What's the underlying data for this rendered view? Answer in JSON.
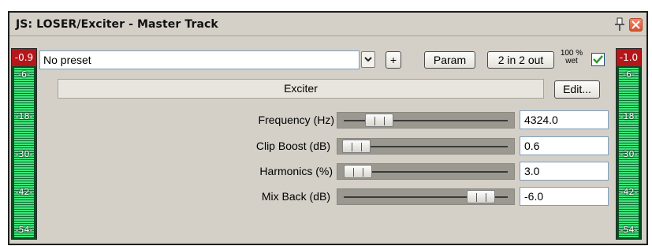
{
  "window": {
    "title": "JS: LOSER/Exciter - Master Track"
  },
  "meters": {
    "left_peak": "-0.9",
    "right_peak": "-1.0",
    "ticks": [
      "-6-",
      "-18-",
      "-30-",
      "-42-",
      "-54-"
    ]
  },
  "toolbar": {
    "preset_value": "No preset",
    "plus_label": "+",
    "param_label": "Param",
    "io_label": "2 in 2 out",
    "wet_percent": "100 %",
    "wet_label": "wet",
    "wet_checked": true
  },
  "effect": {
    "name": "Exciter",
    "edit_label": "Edit..."
  },
  "params": [
    {
      "label": "Frequency (Hz)",
      "value": "4324.0",
      "slider_level": 0.18
    },
    {
      "label": "Clip Boost (dB)",
      "value": "0.6",
      "slider_level": 0.02
    },
    {
      "label": "Harmonics (%)",
      "value": "3.0",
      "slider_level": 0.03
    },
    {
      "label": "Mix Back (dB)",
      "value": "-6.0",
      "slider_level": 0.88
    }
  ],
  "icons": {
    "pin": "pin-icon",
    "close": "close-icon",
    "dropdown": "chevron-down-icon",
    "checkbox": "checkmark-icon"
  },
  "colors": {
    "peak_red": "#b4161a",
    "meter_green": "#3fe67a",
    "check_green": "#2e9a2e"
  }
}
